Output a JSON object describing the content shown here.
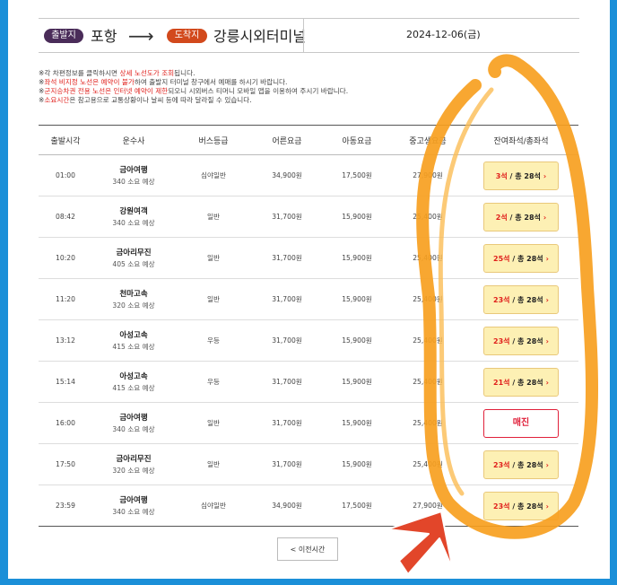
{
  "route": {
    "departure_badge": "출발지",
    "departure_city": "포항",
    "arrow": "⟶",
    "arrival_badge": "도착지",
    "arrival_city": "강릉시외터미널",
    "date": "2024-12-06(금)"
  },
  "notices": [
    {
      "pre": "※각 차편정보를 클릭하시면 ",
      "red": "상세 노선도가 조회",
      "post": "됩니다."
    },
    {
      "pre": "※",
      "red": "좌석 비지정 노선은 예약이 불가",
      "post": "하여 출발지 터미널 창구에서 예매를 하시기 바랍니다."
    },
    {
      "pre": "※",
      "red": "군지승차권 전용 노선은 인터넷 예약이 제한",
      "post": "되오니 시외버스 티머니 모바일 앱을 이용하여 주시기 바랍니다."
    },
    {
      "pre": "※",
      "red": "소요시간",
      "post": "은 참고용으로 교통상황이나 날씨 등에 따라 달라질 수 있습니다."
    }
  ],
  "table": {
    "headers": [
      "출발시각",
      "운수사",
      "버스등급",
      "어른요금",
      "아동요금",
      "중고생요금",
      "잔여좌석/총좌석"
    ],
    "rows": [
      {
        "time": "01:00",
        "company": "금아여행",
        "duration": "340 소요 예상",
        "grade": "심야일반",
        "adult": "34,900원",
        "child": "17,500원",
        "student": "27,900원",
        "remain": "3석",
        "total": "/ 총 28석",
        "sold_out": false
      },
      {
        "time": "08:42",
        "company": "강원여객",
        "duration": "340 소요 예상",
        "grade": "일반",
        "adult": "31,700원",
        "child": "15,900원",
        "student": "25,400원",
        "remain": "2석",
        "total": "/ 총 28석",
        "sold_out": false
      },
      {
        "time": "10:20",
        "company": "금아리무진",
        "duration": "405 소요 예상",
        "grade": "일반",
        "adult": "31,700원",
        "child": "15,900원",
        "student": "25,400원",
        "remain": "25석",
        "total": "/ 총 28석",
        "sold_out": false
      },
      {
        "time": "11:20",
        "company": "천마고속",
        "duration": "320 소요 예상",
        "grade": "일반",
        "adult": "31,700원",
        "child": "15,900원",
        "student": "25,400원",
        "remain": "23석",
        "total": "/ 총 28석",
        "sold_out": false
      },
      {
        "time": "13:12",
        "company": "아성고속",
        "duration": "415 소요 예상",
        "grade": "우등",
        "adult": "31,700원",
        "child": "15,900원",
        "student": "25,400원",
        "remain": "23석",
        "total": "/ 총 28석",
        "sold_out": false
      },
      {
        "time": "15:14",
        "company": "아성고속",
        "duration": "415 소요 예상",
        "grade": "우등",
        "adult": "31,700원",
        "child": "15,900원",
        "student": "25,400원",
        "remain": "21석",
        "total": "/ 총 28석",
        "sold_out": false
      },
      {
        "time": "16:00",
        "company": "금아여행",
        "duration": "340 소요 예상",
        "grade": "일반",
        "adult": "31,700원",
        "child": "15,900원",
        "student": "25,400원",
        "remain": "",
        "total": "",
        "sold_out": true,
        "sold_label": "매진"
      },
      {
        "time": "17:50",
        "company": "금아리무진",
        "duration": "320 소요 예상",
        "grade": "일반",
        "adult": "31,700원",
        "child": "15,900원",
        "student": "25,400원",
        "remain": "23석",
        "total": "/ 총 28석",
        "sold_out": false
      },
      {
        "time": "23:59",
        "company": "금아여행",
        "duration": "340 소요 예상",
        "grade": "심야일반",
        "adult": "34,900원",
        "child": "17,500원",
        "student": "27,900원",
        "remain": "23석",
        "total": "/ 총 28석",
        "sold_out": false
      }
    ]
  },
  "prev_button": "< 이전시간",
  "icons": {
    "seat_chevron": "chevron-right-icon",
    "annotation_arrow": "pointer-arrow-icon"
  },
  "colors": {
    "frame_bg": "#1b8fd8",
    "departure_badge": "#4a2c59",
    "arrival_badge": "#d2491c",
    "highlight": "#f7a020",
    "remain_text": "#e0201c",
    "seat_button_bg": "#fdf0b4"
  }
}
